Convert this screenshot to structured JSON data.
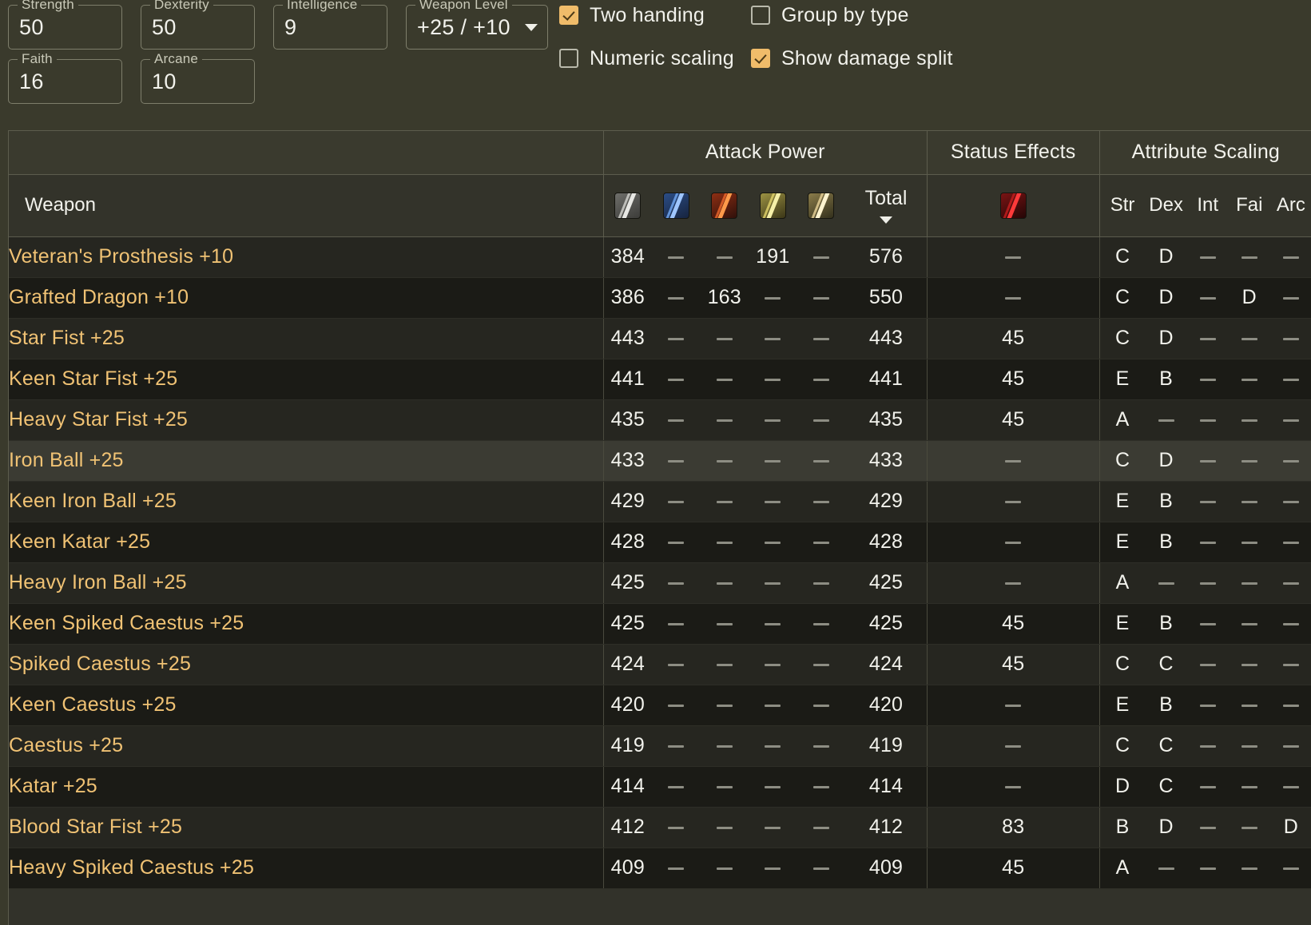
{
  "stats": {
    "fields": [
      {
        "label": "Strength",
        "value": "50"
      },
      {
        "label": "Dexterity",
        "value": "50"
      },
      {
        "label": "Intelligence",
        "value": "9"
      },
      {
        "label": "Faith",
        "value": "16"
      },
      {
        "label": "Arcane",
        "value": "10"
      }
    ],
    "weapon_level": {
      "label": "Weapon Level",
      "value": "+25 / +10"
    }
  },
  "options": [
    {
      "label": "Two handing",
      "checked": true,
      "name": "two-handing"
    },
    {
      "label": "Group by type",
      "checked": false,
      "name": "group-by-type"
    },
    {
      "label": "Numeric scaling",
      "checked": false,
      "name": "numeric-scaling"
    },
    {
      "label": "Show damage split",
      "checked": true,
      "name": "show-damage-split"
    }
  ],
  "table": {
    "group_headers": {
      "attack_power": "Attack Power",
      "status_effects": "Status Effects",
      "attribute_scaling": "Attribute Scaling"
    },
    "weapon_col": "Weapon",
    "total_col": "Total",
    "sort": {
      "column": "Total",
      "direction": "desc",
      "glyph": "▼"
    },
    "damage_icons": [
      {
        "name": "physical-damage-icon",
        "cls": "dmg-phy"
      },
      {
        "name": "magic-damage-icon",
        "cls": "dmg-mag"
      },
      {
        "name": "fire-damage-icon",
        "cls": "dmg-fir"
      },
      {
        "name": "lightning-damage-icon",
        "cls": "dmg-lit"
      },
      {
        "name": "holy-damage-icon",
        "cls": "dmg-hol"
      }
    ],
    "status_icon": {
      "name": "blood-loss-icon",
      "cls": "dmg-blood"
    },
    "attr_cols": [
      "Str",
      "Dex",
      "Int",
      "Fai",
      "Arc"
    ],
    "dash": "—",
    "rows": [
      {
        "weapon": "Veteran's Prosthesis +10",
        "phy": "384",
        "mag": "—",
        "fir": "—",
        "lit": "191",
        "hol": "—",
        "total": "576",
        "status": "—",
        "str": "C",
        "dex": "D",
        "int": "—",
        "fai": "—",
        "arc": "—",
        "hover": false
      },
      {
        "weapon": "Grafted Dragon +10",
        "phy": "386",
        "mag": "—",
        "fir": "163",
        "lit": "—",
        "hol": "—",
        "total": "550",
        "status": "—",
        "str": "C",
        "dex": "D",
        "int": "—",
        "fai": "D",
        "arc": "—",
        "hover": false
      },
      {
        "weapon": "Star Fist +25",
        "phy": "443",
        "mag": "—",
        "fir": "—",
        "lit": "—",
        "hol": "—",
        "total": "443",
        "status": "45",
        "str": "C",
        "dex": "D",
        "int": "—",
        "fai": "—",
        "arc": "—",
        "hover": false
      },
      {
        "weapon": "Keen Star Fist +25",
        "phy": "441",
        "mag": "—",
        "fir": "—",
        "lit": "—",
        "hol": "—",
        "total": "441",
        "status": "45",
        "str": "E",
        "dex": "B",
        "int": "—",
        "fai": "—",
        "arc": "—",
        "hover": false
      },
      {
        "weapon": "Heavy Star Fist +25",
        "phy": "435",
        "mag": "—",
        "fir": "—",
        "lit": "—",
        "hol": "—",
        "total": "435",
        "status": "45",
        "str": "A",
        "dex": "—",
        "int": "—",
        "fai": "—",
        "arc": "—",
        "hover": false
      },
      {
        "weapon": "Iron Ball +25",
        "phy": "433",
        "mag": "—",
        "fir": "—",
        "lit": "—",
        "hol": "—",
        "total": "433",
        "status": "—",
        "str": "C",
        "dex": "D",
        "int": "—",
        "fai": "—",
        "arc": "—",
        "hover": true
      },
      {
        "weapon": "Keen Iron Ball +25",
        "phy": "429",
        "mag": "—",
        "fir": "—",
        "lit": "—",
        "hol": "—",
        "total": "429",
        "status": "—",
        "str": "E",
        "dex": "B",
        "int": "—",
        "fai": "—",
        "arc": "—",
        "hover": false
      },
      {
        "weapon": "Keen Katar +25",
        "phy": "428",
        "mag": "—",
        "fir": "—",
        "lit": "—",
        "hol": "—",
        "total": "428",
        "status": "—",
        "str": "E",
        "dex": "B",
        "int": "—",
        "fai": "—",
        "arc": "—",
        "hover": false
      },
      {
        "weapon": "Heavy Iron Ball +25",
        "phy": "425",
        "mag": "—",
        "fir": "—",
        "lit": "—",
        "hol": "—",
        "total": "425",
        "status": "—",
        "str": "A",
        "dex": "—",
        "int": "—",
        "fai": "—",
        "arc": "—",
        "hover": false
      },
      {
        "weapon": "Keen Spiked Caestus +25",
        "phy": "425",
        "mag": "—",
        "fir": "—",
        "lit": "—",
        "hol": "—",
        "total": "425",
        "status": "45",
        "str": "E",
        "dex": "B",
        "int": "—",
        "fai": "—",
        "arc": "—",
        "hover": false
      },
      {
        "weapon": "Spiked Caestus +25",
        "phy": "424",
        "mag": "—",
        "fir": "—",
        "lit": "—",
        "hol": "—",
        "total": "424",
        "status": "45",
        "str": "C",
        "dex": "C",
        "int": "—",
        "fai": "—",
        "arc": "—",
        "hover": false
      },
      {
        "weapon": "Keen Caestus +25",
        "phy": "420",
        "mag": "—",
        "fir": "—",
        "lit": "—",
        "hol": "—",
        "total": "420",
        "status": "—",
        "str": "E",
        "dex": "B",
        "int": "—",
        "fai": "—",
        "arc": "—",
        "hover": false
      },
      {
        "weapon": "Caestus +25",
        "phy": "419",
        "mag": "—",
        "fir": "—",
        "lit": "—",
        "hol": "—",
        "total": "419",
        "status": "—",
        "str": "C",
        "dex": "C",
        "int": "—",
        "fai": "—",
        "arc": "—",
        "hover": false
      },
      {
        "weapon": "Katar +25",
        "phy": "414",
        "mag": "—",
        "fir": "—",
        "lit": "—",
        "hol": "—",
        "total": "414",
        "status": "—",
        "str": "D",
        "dex": "C",
        "int": "—",
        "fai": "—",
        "arc": "—",
        "hover": false
      },
      {
        "weapon": "Blood Star Fist +25",
        "phy": "412",
        "mag": "—",
        "fir": "—",
        "lit": "—",
        "hol": "—",
        "total": "412",
        "status": "83",
        "str": "B",
        "dex": "D",
        "int": "—",
        "fai": "—",
        "arc": "D",
        "hover": false
      },
      {
        "weapon": "Heavy Spiked Caestus +25",
        "phy": "409",
        "mag": "—",
        "fir": "—",
        "lit": "—",
        "hol": "—",
        "total": "409",
        "status": "45",
        "str": "A",
        "dex": "—",
        "int": "—",
        "fai": "—",
        "arc": "—",
        "hover": false
      }
    ]
  },
  "colors": {
    "accent": "#f0bc6a",
    "weapon_name": "#f0c274",
    "page_bg": "#3a3a2c",
    "text": "#f2f2ec"
  }
}
